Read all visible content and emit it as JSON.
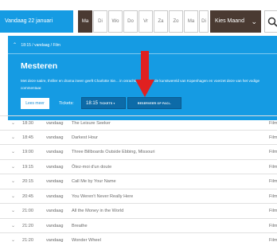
{
  "datebar": {
    "date_label": "Vandaag 22 januari",
    "days": [
      "Ma",
      "Di",
      "Wo",
      "Do",
      "Vr",
      "Za",
      "Zo",
      "Ma",
      "Di"
    ],
    "active_index": 0,
    "month_select": "Kies Maand",
    "search_icon": "search-icon"
  },
  "panel": {
    "breadcrumb": "18:15 / vandaag / Film",
    "title": "Mesteren",
    "description": "Met deze satire, thriller en drama ineen geeft Charlotte Sie... in onrachtige inkijk in de kunstwereld van Kopenhagen en voerzet deze van het vodige commentaar.",
    "more_label": "Lees meer",
    "tickets_label": "Tickets:",
    "ticket_time": "18:15",
    "ticket_kind": "TICKETS ▾",
    "reserve_label": "RESERVEER OP FACL."
  },
  "colors": {
    "brand_blue": "#159be3",
    "dark_brown": "#4a3a32",
    "arrow_red": "#e02020"
  },
  "rows": [
    {
      "time": "18:30",
      "date": "vandaag",
      "title": "The Leisure Seeker",
      "type": "Film"
    },
    {
      "time": "18:45",
      "date": "vandaag",
      "title": "Darkest Hour",
      "type": "Film"
    },
    {
      "time": "19:00",
      "date": "vandaag",
      "title": "Three Billboards Outside Ebbing, Missouri",
      "type": "Film"
    },
    {
      "time": "19:15",
      "date": "vandaag",
      "title": "Ôtez-moi d'un doute",
      "type": "Film"
    },
    {
      "time": "20:15",
      "date": "vandaag",
      "title": "Call Me by Your Name",
      "type": "Film"
    },
    {
      "time": "20:45",
      "date": "vandaag",
      "title": "You Weren't Never Really Here",
      "type": "Film"
    },
    {
      "time": "21:00",
      "date": "vandaag",
      "title": "All the Money in the World",
      "type": "Film"
    },
    {
      "time": "21:20",
      "date": "vandaag",
      "title": "Breathe",
      "type": "Film"
    },
    {
      "time": "21:20",
      "date": "vandaag",
      "title": "Wonder Wheel",
      "type": "Film"
    }
  ]
}
